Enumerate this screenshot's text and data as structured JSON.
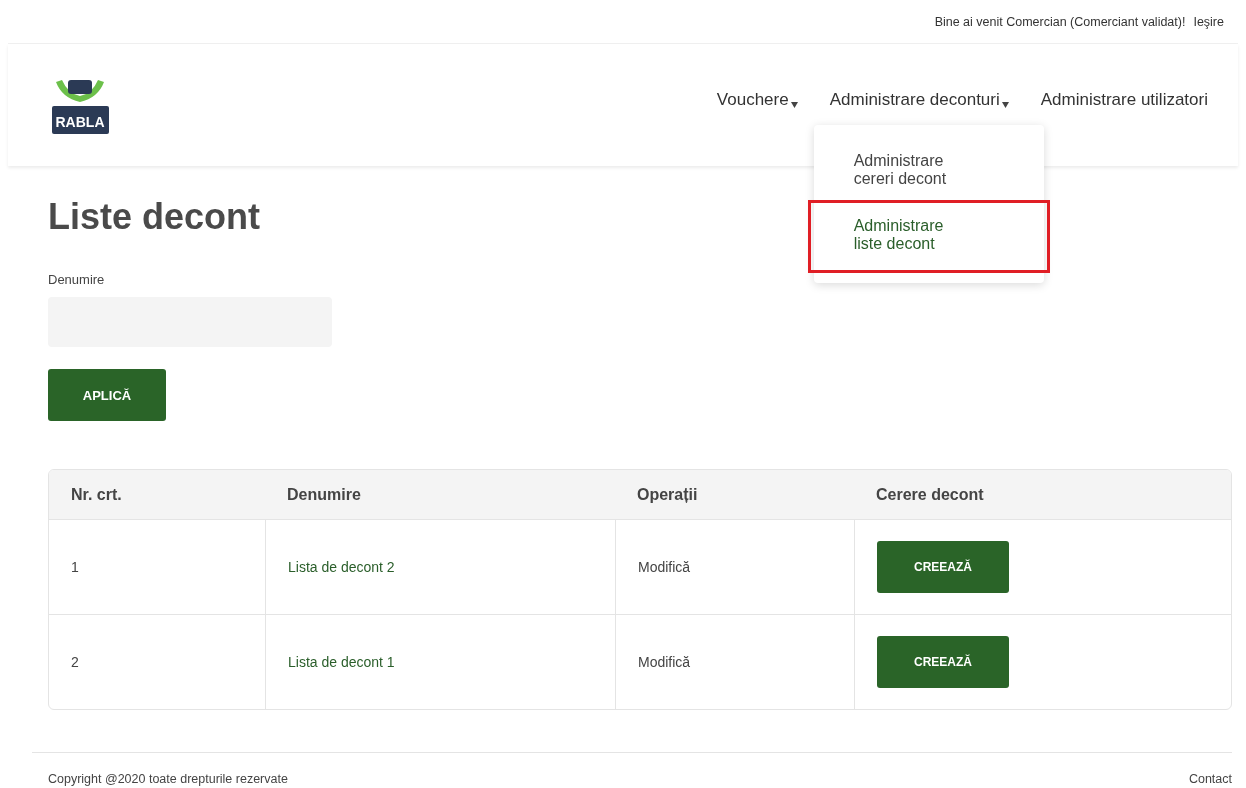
{
  "top_bar": {
    "welcome": "Bine ai venit Comercian (Comerciant validat)!",
    "logout": "Ieşire"
  },
  "logo": {
    "text": "RABLA"
  },
  "nav": [
    {
      "label": "Vouchere",
      "has_menu": true
    },
    {
      "label": "Administrare deconturi",
      "has_menu": true,
      "menu": [
        {
          "label": "Administrare cereri decont",
          "selected": false
        },
        {
          "label": "Administrare liste decont",
          "selected": true
        }
      ]
    },
    {
      "label": "Administrare utilizatori",
      "has_menu": false
    }
  ],
  "page_title": "Liste decont",
  "filter": {
    "label": "Denumire",
    "button": "APLICĂ"
  },
  "table": {
    "columns": [
      "Nr. crt.",
      "Denumire",
      "Operații",
      "Cerere decont"
    ],
    "rows": [
      {
        "nr": "1",
        "name": "Lista de decont 2",
        "operation": "Modifică",
        "action": "CREEAZĂ"
      },
      {
        "nr": "2",
        "name": "Lista de decont 1",
        "operation": "Modifică",
        "action": "CREEAZĂ"
      }
    ]
  },
  "footer": {
    "copyright": "Copyright @2020 toate drepturile rezervate",
    "contact": "Contact"
  }
}
